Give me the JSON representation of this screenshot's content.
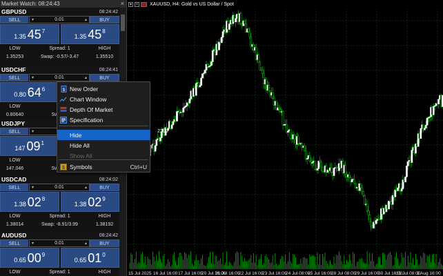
{
  "market_watch": {
    "title": "Market Watch: 08:24:43",
    "symbols": [
      {
        "name": "GBPUSD",
        "time": "08:24:42",
        "sell": "SELL",
        "buy": "BUY",
        "lot": "0.01",
        "bid_small": "1.35",
        "bid_big": "45",
        "bid_sup": "7",
        "ask_small": "1.35",
        "ask_big": "45",
        "ask_sup": "8",
        "low_label": "LOW",
        "spread": "Spread: 1",
        "high_label": "HIGH",
        "low": "1.35253",
        "swap": "Swap: -0.57/-3.47",
        "high": "1.35510"
      },
      {
        "name": "USDCHF",
        "time": "08:24:41",
        "sell": "SELL",
        "buy": "BUY",
        "lot": "0.01",
        "bid_small": "0.80",
        "bid_big": "64",
        "bid_sup": "6",
        "ask_small": "",
        "ask_big": "",
        "ask_sup": "",
        "low_label": "LOW",
        "spread": "",
        "high_label": "",
        "low": "0.80640",
        "swap": "Swap: -",
        "high": ""
      },
      {
        "name": "USDJPY",
        "time": "",
        "sell": "SELL",
        "buy": "",
        "lot": "",
        "bid_small": "147",
        "bid_big": "09",
        "bid_sup": "1",
        "ask_small": "",
        "ask_big": "",
        "ask_sup": "",
        "low_label": "LOW",
        "spread": "",
        "high_label": "",
        "low": "147.046",
        "swap": "Swap: -",
        "high": ""
      },
      {
        "name": "USDCAD",
        "time": "08:24:02",
        "sell": "SELL",
        "buy": "BUY",
        "lot": "0.01",
        "bid_small": "1.38",
        "bid_big": "02",
        "bid_sup": "8",
        "ask_small": "1.38",
        "ask_big": "02",
        "ask_sup": "9",
        "low_label": "LOW",
        "spread": "Spread: 1",
        "high_label": "HIGH",
        "low": "1.38014",
        "swap": "Swap: -8.91/3.99",
        "high": "1.38192"
      },
      {
        "name": "AUDUSD",
        "time": "08:24:42",
        "sell": "SELL",
        "buy": "BUY",
        "lot": "0.01",
        "bid_small": "0.65",
        "bid_big": "00",
        "bid_sup": "9",
        "ask_small": "0.65",
        "ask_big": "01",
        "ask_sup": "0",
        "low_label": "LOW",
        "spread": "Spread: 1",
        "high_label": "HIGH",
        "low": "",
        "swap": "",
        "high": ""
      }
    ]
  },
  "chart": {
    "title": "XAUUSD, H4:  Gold vs US Dollar / Spot",
    "partial_label": "2290",
    "x_labels": [
      "15 Jul 2025",
      "16 Jul 16:00",
      "17 Jul 16:00",
      "20 Jul 16:00",
      "21 Jul 16:00",
      "22 Jul 16:00",
      "23 Jul 16:00",
      "24 Jul 08:00",
      "25 Jul 16:00",
      "28 Jul 08:00",
      "29 Jul 16:00",
      "30 Jul 16:00",
      "31 Jul 08:00",
      "1 Aug 16:00"
    ],
    "candle_color": "#ffffff",
    "bear_color": "#00d000",
    "grid_color": "#1f3a1f"
  },
  "context_menu": {
    "items": [
      {
        "label": "New Order",
        "icon": "new-order-icon",
        "shortcut": "",
        "state": "normal"
      },
      {
        "label": "Chart Window",
        "icon": "chart-window-icon",
        "shortcut": "",
        "state": "normal"
      },
      {
        "label": "Depth Of Market",
        "icon": "depth-of-market-icon",
        "shortcut": "",
        "state": "normal"
      },
      {
        "label": "Specification",
        "icon": "specification-icon",
        "shortcut": "",
        "state": "normal"
      },
      {
        "label": "Hide",
        "icon": "",
        "shortcut": "",
        "state": "highlighted"
      },
      {
        "label": "Hide All",
        "icon": "",
        "shortcut": "",
        "state": "normal"
      },
      {
        "label": "Show All",
        "icon": "",
        "shortcut": "",
        "state": "disabled"
      },
      {
        "label": "Symbols",
        "icon": "symbols-icon",
        "shortcut": "Ctrl+U",
        "state": "normal"
      }
    ]
  }
}
